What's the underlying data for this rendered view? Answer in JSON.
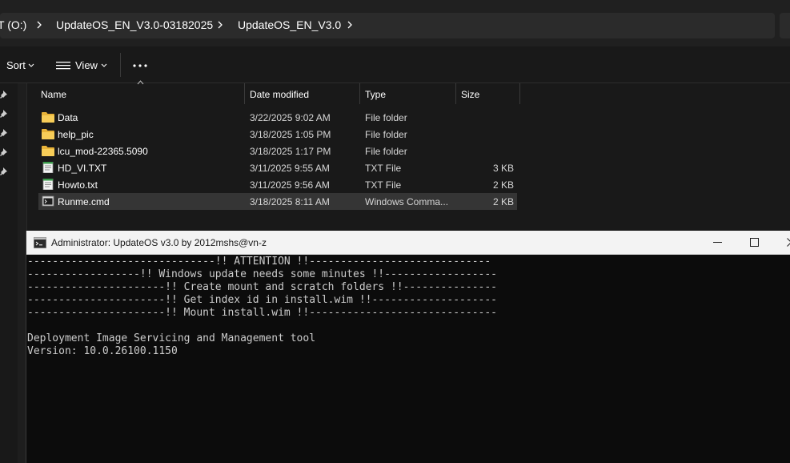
{
  "address": {
    "crumbs": [
      "T (O:)",
      "UpdateOS_EN_V3.0-03182025",
      "UpdateOS_EN_V3.0"
    ]
  },
  "toolbar": {
    "sort_label": "Sort",
    "view_label": "View"
  },
  "columns": {
    "name": "Name",
    "date": "Date modified",
    "type": "Type",
    "size": "Size"
  },
  "files": [
    {
      "name": "Data",
      "date": "3/22/2025 9:02 AM",
      "type": "File folder",
      "size": "",
      "icon": "folder-icon"
    },
    {
      "name": "help_pic",
      "date": "3/18/2025 1:05 PM",
      "type": "File folder",
      "size": "",
      "icon": "folder-icon"
    },
    {
      "name": "lcu_mod-22365.5090",
      "date": "3/18/2025 1:17 PM",
      "type": "File folder",
      "size": "",
      "icon": "folder-icon"
    },
    {
      "name": "HD_VI.TXT",
      "date": "3/11/2025 9:55 AM",
      "type": "TXT File",
      "size": "3 KB",
      "icon": "notepad-file-icon"
    },
    {
      "name": "Howto.txt",
      "date": "3/11/2025 9:56 AM",
      "type": "TXT File",
      "size": "2 KB",
      "icon": "notepad-file-icon"
    },
    {
      "name": "Runme.cmd",
      "date": "3/18/2025 8:11 AM",
      "type": "Windows Comma...",
      "size": "2 KB",
      "icon": "cmd-file-icon"
    }
  ],
  "console": {
    "title": "Administrator:  UpdateOS v3.0 by 2012mshs@vn-z",
    "lines": [
      "------------------------------!! ATTENTION !!-----------------------------",
      "------------------!! Windows update needs some minutes !!------------------",
      "----------------------!! Create mount and scratch folders !!---------------",
      "----------------------!! Get index id in install.wim !!--------------------",
      "----------------------!! Mount install.wim !!------------------------------",
      "",
      "Deployment Image Servicing and Management tool",
      "Version: 10.0.26100.1150"
    ]
  },
  "colors": {
    "explorer_bg": "#191919",
    "folder": "#f2c14e",
    "console_bg": "#0c0c0c",
    "console_text": "#cccccc",
    "titlebar_bg": "#f3f3f3"
  }
}
